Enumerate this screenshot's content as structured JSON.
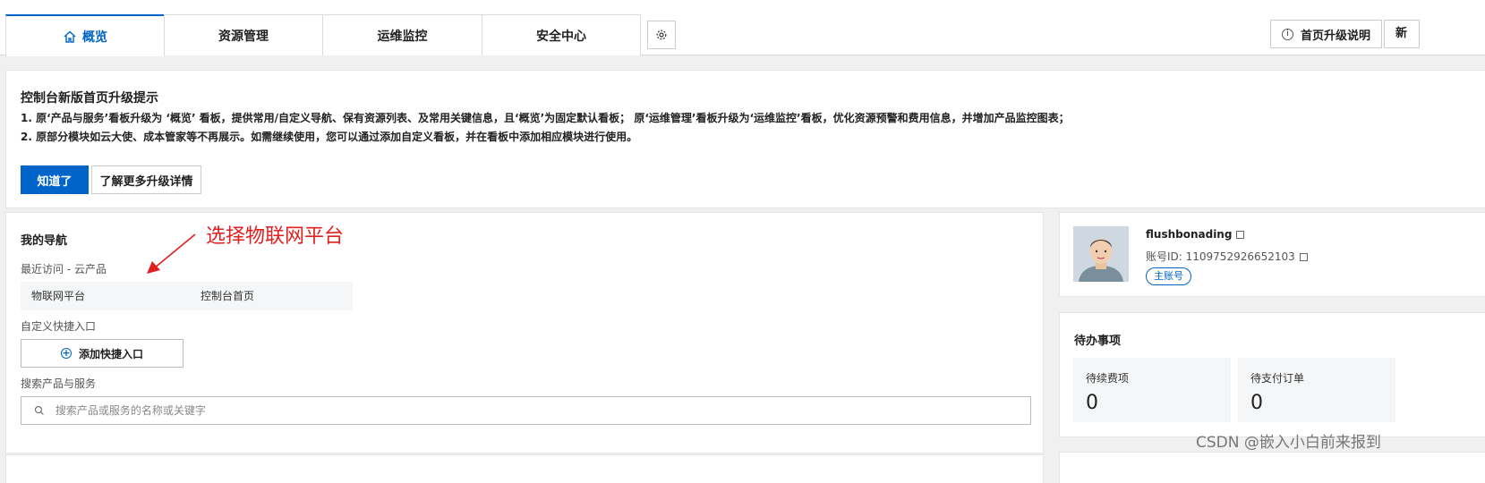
{
  "tabs": [
    {
      "label": "概览",
      "active": true,
      "icon": "home-icon"
    },
    {
      "label": "资源管理",
      "active": false
    },
    {
      "label": "运维监控",
      "active": false
    },
    {
      "label": "安全中心",
      "active": false
    }
  ],
  "toolbar": {
    "settings_icon": "gear-icon",
    "upgrade_info_label": "首页升级说明",
    "new_label": "新"
  },
  "notice": {
    "title": "控制台新版首页升级提示",
    "line1": "1. 原‘产品与服务’看板升级为 ‘概览’ 看板，提供常用/自定义导航、保有资源列表、及常用关键信息，且‘概览’为固定默认看板； 原‘运维管理’看板升级为‘运维监控’看板，优化资源预警和费用信息，并增加产品监控图表；",
    "line2": "2. 原部分模块如云大使、成本管家等不再展示。如需继续使用，您可以通过添加自定义看板，并在看板中添加相应模块进行使用。",
    "ok_label": "知道了",
    "more_label": "了解更多升级详情"
  },
  "nav": {
    "title": "我的导航",
    "recent_label": "最近访问 - 云产品",
    "recent_items": [
      "物联网平台",
      "控制台首页"
    ],
    "custom_label": "自定义快捷入口",
    "add_label": "添加快捷入口",
    "search_label": "搜索产品与服务",
    "search_placeholder": "搜索产品或服务的名称或关键字"
  },
  "annotation": {
    "text": "选择物联网平台",
    "color": "#e0201f"
  },
  "account": {
    "name": "flushbonading",
    "id_text": "账号ID: 1109752926652103",
    "badge": "主账号"
  },
  "todo": {
    "title": "待办事项",
    "cards": [
      {
        "label": "待续费项",
        "value": "0"
      },
      {
        "label": "待支付订单",
        "value": "0"
      }
    ]
  },
  "watermark": "CSDN @嵌入小白前来报到",
  "colors": {
    "accent": "#0064c8",
    "annotation": "#e0201f"
  }
}
